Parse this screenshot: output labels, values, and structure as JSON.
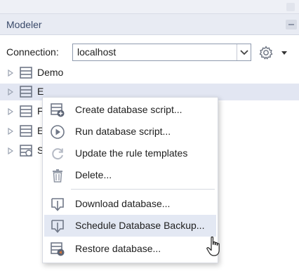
{
  "panel": {
    "title": "Modeler"
  },
  "connection": {
    "label": "Connection:",
    "value": "localhost"
  },
  "tree": {
    "items": [
      {
        "label": "Demo"
      },
      {
        "label": "E"
      },
      {
        "label": "F"
      },
      {
        "label": "E"
      },
      {
        "label": "S"
      }
    ]
  },
  "context_menu": {
    "items": [
      {
        "label": "Create database script...",
        "icon": "create-script-icon"
      },
      {
        "label": "Run database script...",
        "icon": "run-icon"
      },
      {
        "label": "Update the rule templates",
        "icon": "refresh-icon"
      },
      {
        "label": "Delete...",
        "icon": "trash-icon"
      },
      {
        "label": "Download database...",
        "icon": "download-icon"
      },
      {
        "label": "Schedule Database Backup...",
        "icon": "download-icon"
      },
      {
        "label": "Restore database...",
        "icon": "restore-icon"
      }
    ]
  },
  "colors": {
    "panel_header_bg": "#e8ebf3",
    "selection_bg": "#e2e6f2",
    "menu_hover_bg": "#e3e8f3",
    "icon_gray": "#6f7787",
    "accent_orange": "#e8742c"
  }
}
